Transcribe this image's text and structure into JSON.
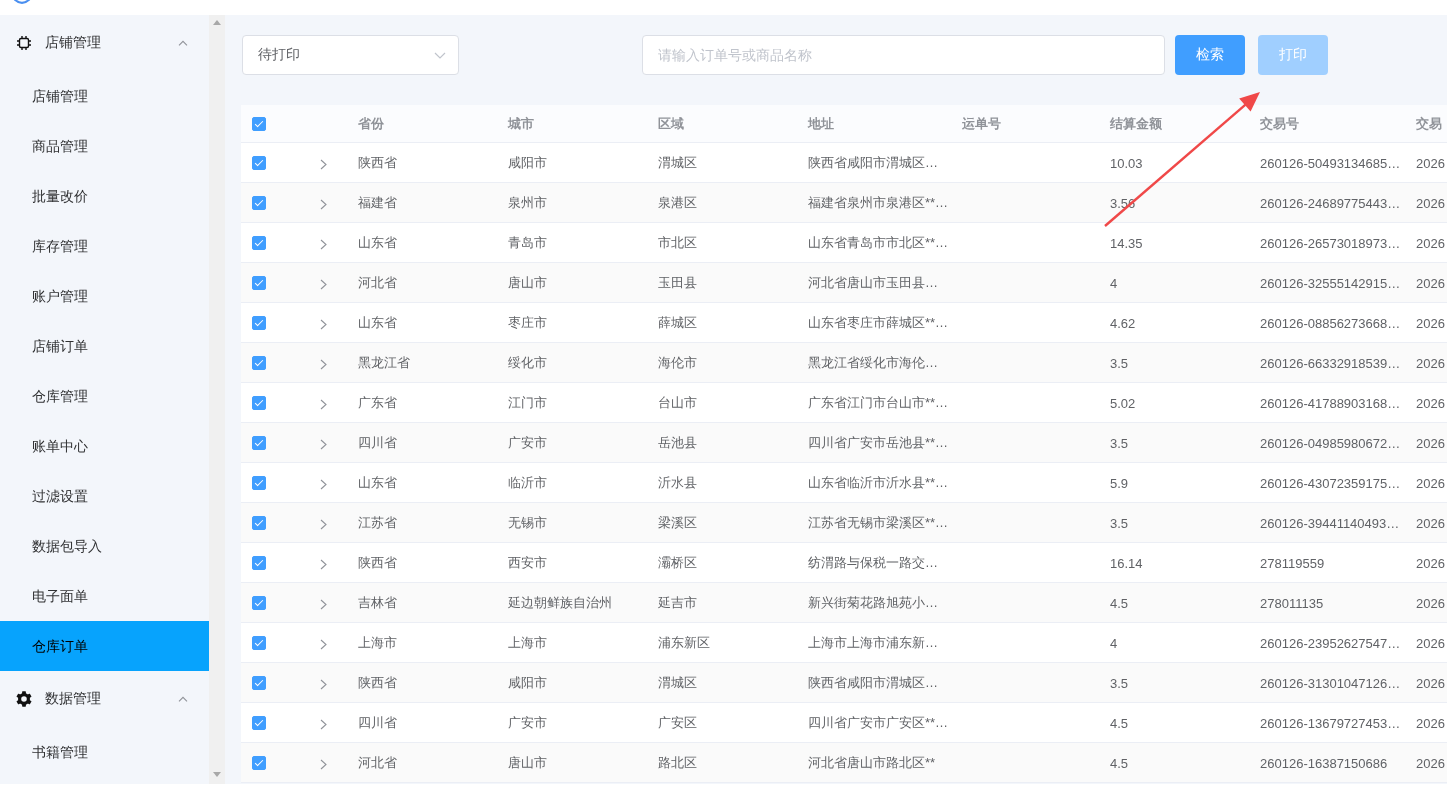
{
  "sidebar": {
    "groups": [
      {
        "label": "店铺管理",
        "expanded": true,
        "items": [
          {
            "label": "店铺管理",
            "selected": false
          },
          {
            "label": "商品管理",
            "selected": false
          },
          {
            "label": "批量改价",
            "selected": false
          },
          {
            "label": "库存管理",
            "selected": false
          },
          {
            "label": "账户管理",
            "selected": false
          },
          {
            "label": "店铺订单",
            "selected": false
          },
          {
            "label": "仓库管理",
            "selected": false
          },
          {
            "label": "账单中心",
            "selected": false
          },
          {
            "label": "过滤设置",
            "selected": false
          },
          {
            "label": "数据包导入",
            "selected": false
          },
          {
            "label": "电子面单",
            "selected": false
          },
          {
            "label": "仓库订单",
            "selected": true
          }
        ]
      },
      {
        "label": "数据管理",
        "expanded": true,
        "items": [
          {
            "label": "书籍管理",
            "selected": false
          }
        ]
      }
    ]
  },
  "toolbar": {
    "status_select": {
      "value": "待打印"
    },
    "search": {
      "placeholder": "请输入订单号或商品名称"
    },
    "buttons": [
      {
        "label": "检索",
        "disabled": false
      },
      {
        "label": "打印",
        "disabled": true
      }
    ]
  },
  "table": {
    "select_all_checked": true,
    "columns": [
      "省份",
      "城市",
      "区域",
      "地址",
      "运单号",
      "结算金额",
      "交易号",
      "交易"
    ],
    "rows": [
      {
        "checked": true,
        "expanded": false,
        "province": "陕西省",
        "city": "咸阳市",
        "district": "渭城区",
        "address": "陕西省咸阳市渭城区…",
        "amount": "10.03",
        "transaction_no": "260126-50493134685…",
        "column_10": "2026"
      },
      {
        "checked": true,
        "expanded": false,
        "province": "福建省",
        "city": "泉州市",
        "district": "泉港区",
        "address": "福建省泉州市泉港区**…",
        "amount": "3.56",
        "transaction_no": "260126-24689775443…",
        "column_10": "2026"
      },
      {
        "checked": true,
        "expanded": false,
        "province": "山东省",
        "city": "青岛市",
        "district": "市北区",
        "address": "山东省青岛市市北区**…",
        "amount": "14.35",
        "transaction_no": "260126-26573018973…",
        "column_10": "2026"
      },
      {
        "checked": true,
        "expanded": false,
        "province": "河北省",
        "city": "唐山市",
        "district": "玉田县",
        "address": "河北省唐山市玉田县…",
        "amount": "4",
        "transaction_no": "260126-32555142915…",
        "column_10": "2026"
      },
      {
        "checked": true,
        "expanded": false,
        "province": "山东省",
        "city": "枣庄市",
        "district": "薛城区",
        "address": "山东省枣庄市薛城区**…",
        "amount": "4.62",
        "transaction_no": "260126-08856273668…",
        "column_10": "2026"
      },
      {
        "checked": true,
        "expanded": false,
        "province": "黑龙江省",
        "city": "绥化市",
        "district": "海伦市",
        "address": "黑龙江省绥化市海伦…",
        "amount": "3.5",
        "transaction_no": "260126-66332918539…",
        "column_10": "2026"
      },
      {
        "checked": true,
        "expanded": false,
        "province": "广东省",
        "city": "江门市",
        "district": "台山市",
        "address": "广东省江门市台山市**…",
        "amount": "5.02",
        "transaction_no": "260126-41788903168…",
        "column_10": "2026"
      },
      {
        "checked": true,
        "expanded": false,
        "province": "四川省",
        "city": "广安市",
        "district": "岳池县",
        "address": "四川省广安市岳池县**…",
        "amount": "3.5",
        "transaction_no": "260126-04985980672…",
        "column_10": "2026"
      },
      {
        "checked": true,
        "expanded": false,
        "province": "山东省",
        "city": "临沂市",
        "district": "沂水县",
        "address": "山东省临沂市沂水县**…",
        "amount": "5.9",
        "transaction_no": "260126-43072359175…",
        "column_10": "2026"
      },
      {
        "checked": true,
        "expanded": false,
        "province": "江苏省",
        "city": "无锡市",
        "district": "梁溪区",
        "address": "江苏省无锡市梁溪区**…",
        "amount": "3.5",
        "transaction_no": "260126-39441140493…",
        "column_10": "2026"
      },
      {
        "checked": true,
        "expanded": false,
        "province": "陕西省",
        "city": "西安市",
        "district": "灞桥区",
        "address": "纺渭路与保税一路交…",
        "amount": "16.14",
        "transaction_no": "278119559",
        "column_10": "2026"
      },
      {
        "checked": true,
        "expanded": false,
        "province": "吉林省",
        "city": "延边朝鲜族自治州",
        "district": "延吉市",
        "address": "新兴街菊花路旭苑小…",
        "amount": "4.5",
        "transaction_no": "278011135",
        "column_10": "2026"
      },
      {
        "checked": true,
        "expanded": false,
        "province": "上海市",
        "city": "上海市",
        "district": "浦东新区",
        "address": "上海市上海市浦东新…",
        "amount": "4",
        "transaction_no": "260126-23952627547…",
        "column_10": "2026"
      },
      {
        "checked": true,
        "expanded": false,
        "province": "陕西省",
        "city": "咸阳市",
        "district": "渭城区",
        "address": "陕西省咸阳市渭城区…",
        "amount": "3.5",
        "transaction_no": "260126-31301047126…",
        "column_10": "2026"
      },
      {
        "checked": true,
        "expanded": false,
        "province": "四川省",
        "city": "广安市",
        "district": "广安区",
        "address": "四川省广安市广安区**…",
        "amount": "4.5",
        "transaction_no": "260126-13679727453…",
        "column_10": "2026"
      },
      {
        "checked": true,
        "expanded": false,
        "province": "河北省",
        "city": "唐山市",
        "district": "路北区",
        "address": "河北省唐山市路北区**",
        "amount": "4.5",
        "transaction_no": "260126-16387150686",
        "column_10": "2026"
      }
    ]
  }
}
